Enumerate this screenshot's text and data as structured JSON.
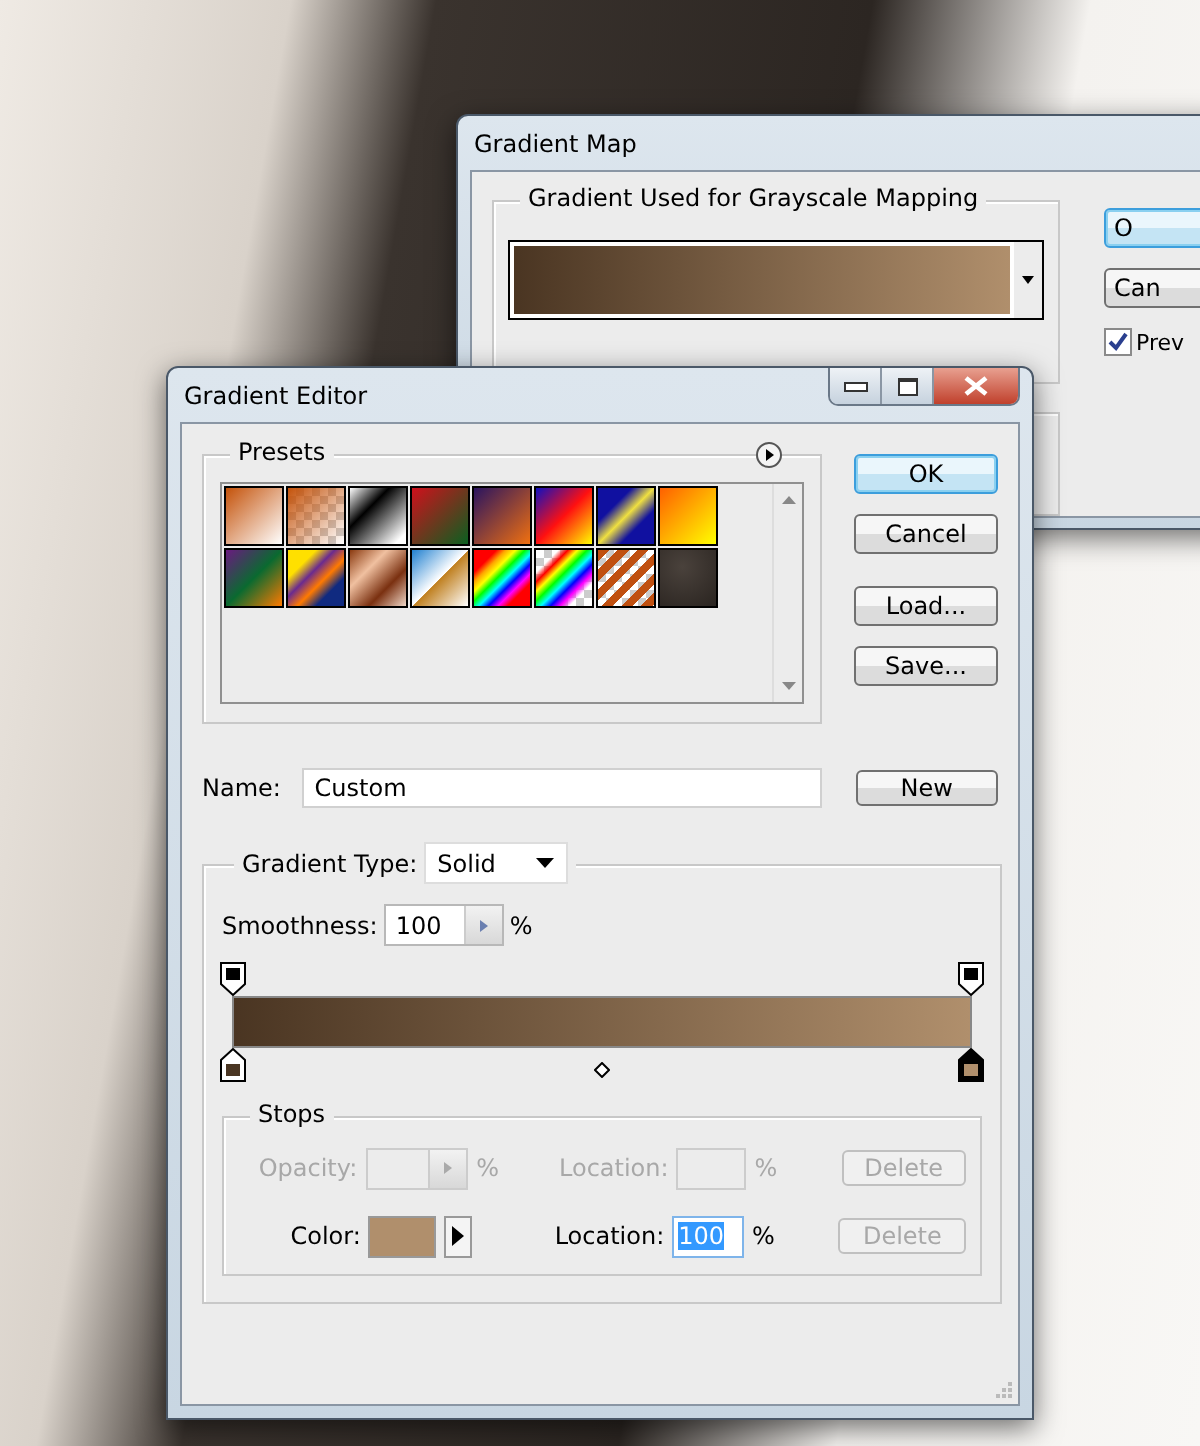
{
  "gradient_map": {
    "title": "Gradient Map",
    "group_title": "Gradient Used for Grayscale Mapping",
    "gradient": [
      {
        "color": "#4a3522"
      },
      {
        "color": "#b08f6c"
      }
    ],
    "buttons": [
      {
        "label": "O",
        "default": true
      },
      {
        "label": "Can",
        "default": false
      }
    ],
    "preview": {
      "label": "Prev",
      "checked": true
    }
  },
  "gradient_editor": {
    "title": "Gradient Editor",
    "presets_title": "Presets",
    "buttons": [
      {
        "label": "OK",
        "default": true
      },
      {
        "label": "Cancel",
        "default": false
      },
      {
        "label": "Load...",
        "default": false
      },
      {
        "label": "Save...",
        "default": false
      }
    ],
    "name": {
      "label": "Name:",
      "value": "Custom"
    },
    "new_button": "New",
    "gradient_type": {
      "label": "Gradient Type:",
      "value": "Solid"
    },
    "smoothness": {
      "label": "Smoothness:",
      "value": "100",
      "unit": "%"
    },
    "opacity_stops": [
      {
        "selected": false
      },
      {
        "selected": false
      }
    ],
    "color_stops": [
      {
        "color": "#4a3522",
        "selected": false
      },
      {
        "color": "#b08f6c",
        "selected": true
      }
    ],
    "stops": {
      "title": "Stops",
      "rows": [
        {
          "kind": "opacity",
          "label": "Opacity:",
          "unit": "%",
          "location_label": "Location:",
          "location_unit": "%",
          "delete": "Delete",
          "disabled": true,
          "delete_disabled": true
        },
        {
          "kind": "color",
          "label": "Color:",
          "color": "#b08f6c",
          "location_label": "Location:",
          "location_value": "100",
          "value_selected": true,
          "location_unit": "%",
          "delete": "Delete",
          "disabled": false,
          "delete_disabled": true
        }
      ]
    }
  }
}
